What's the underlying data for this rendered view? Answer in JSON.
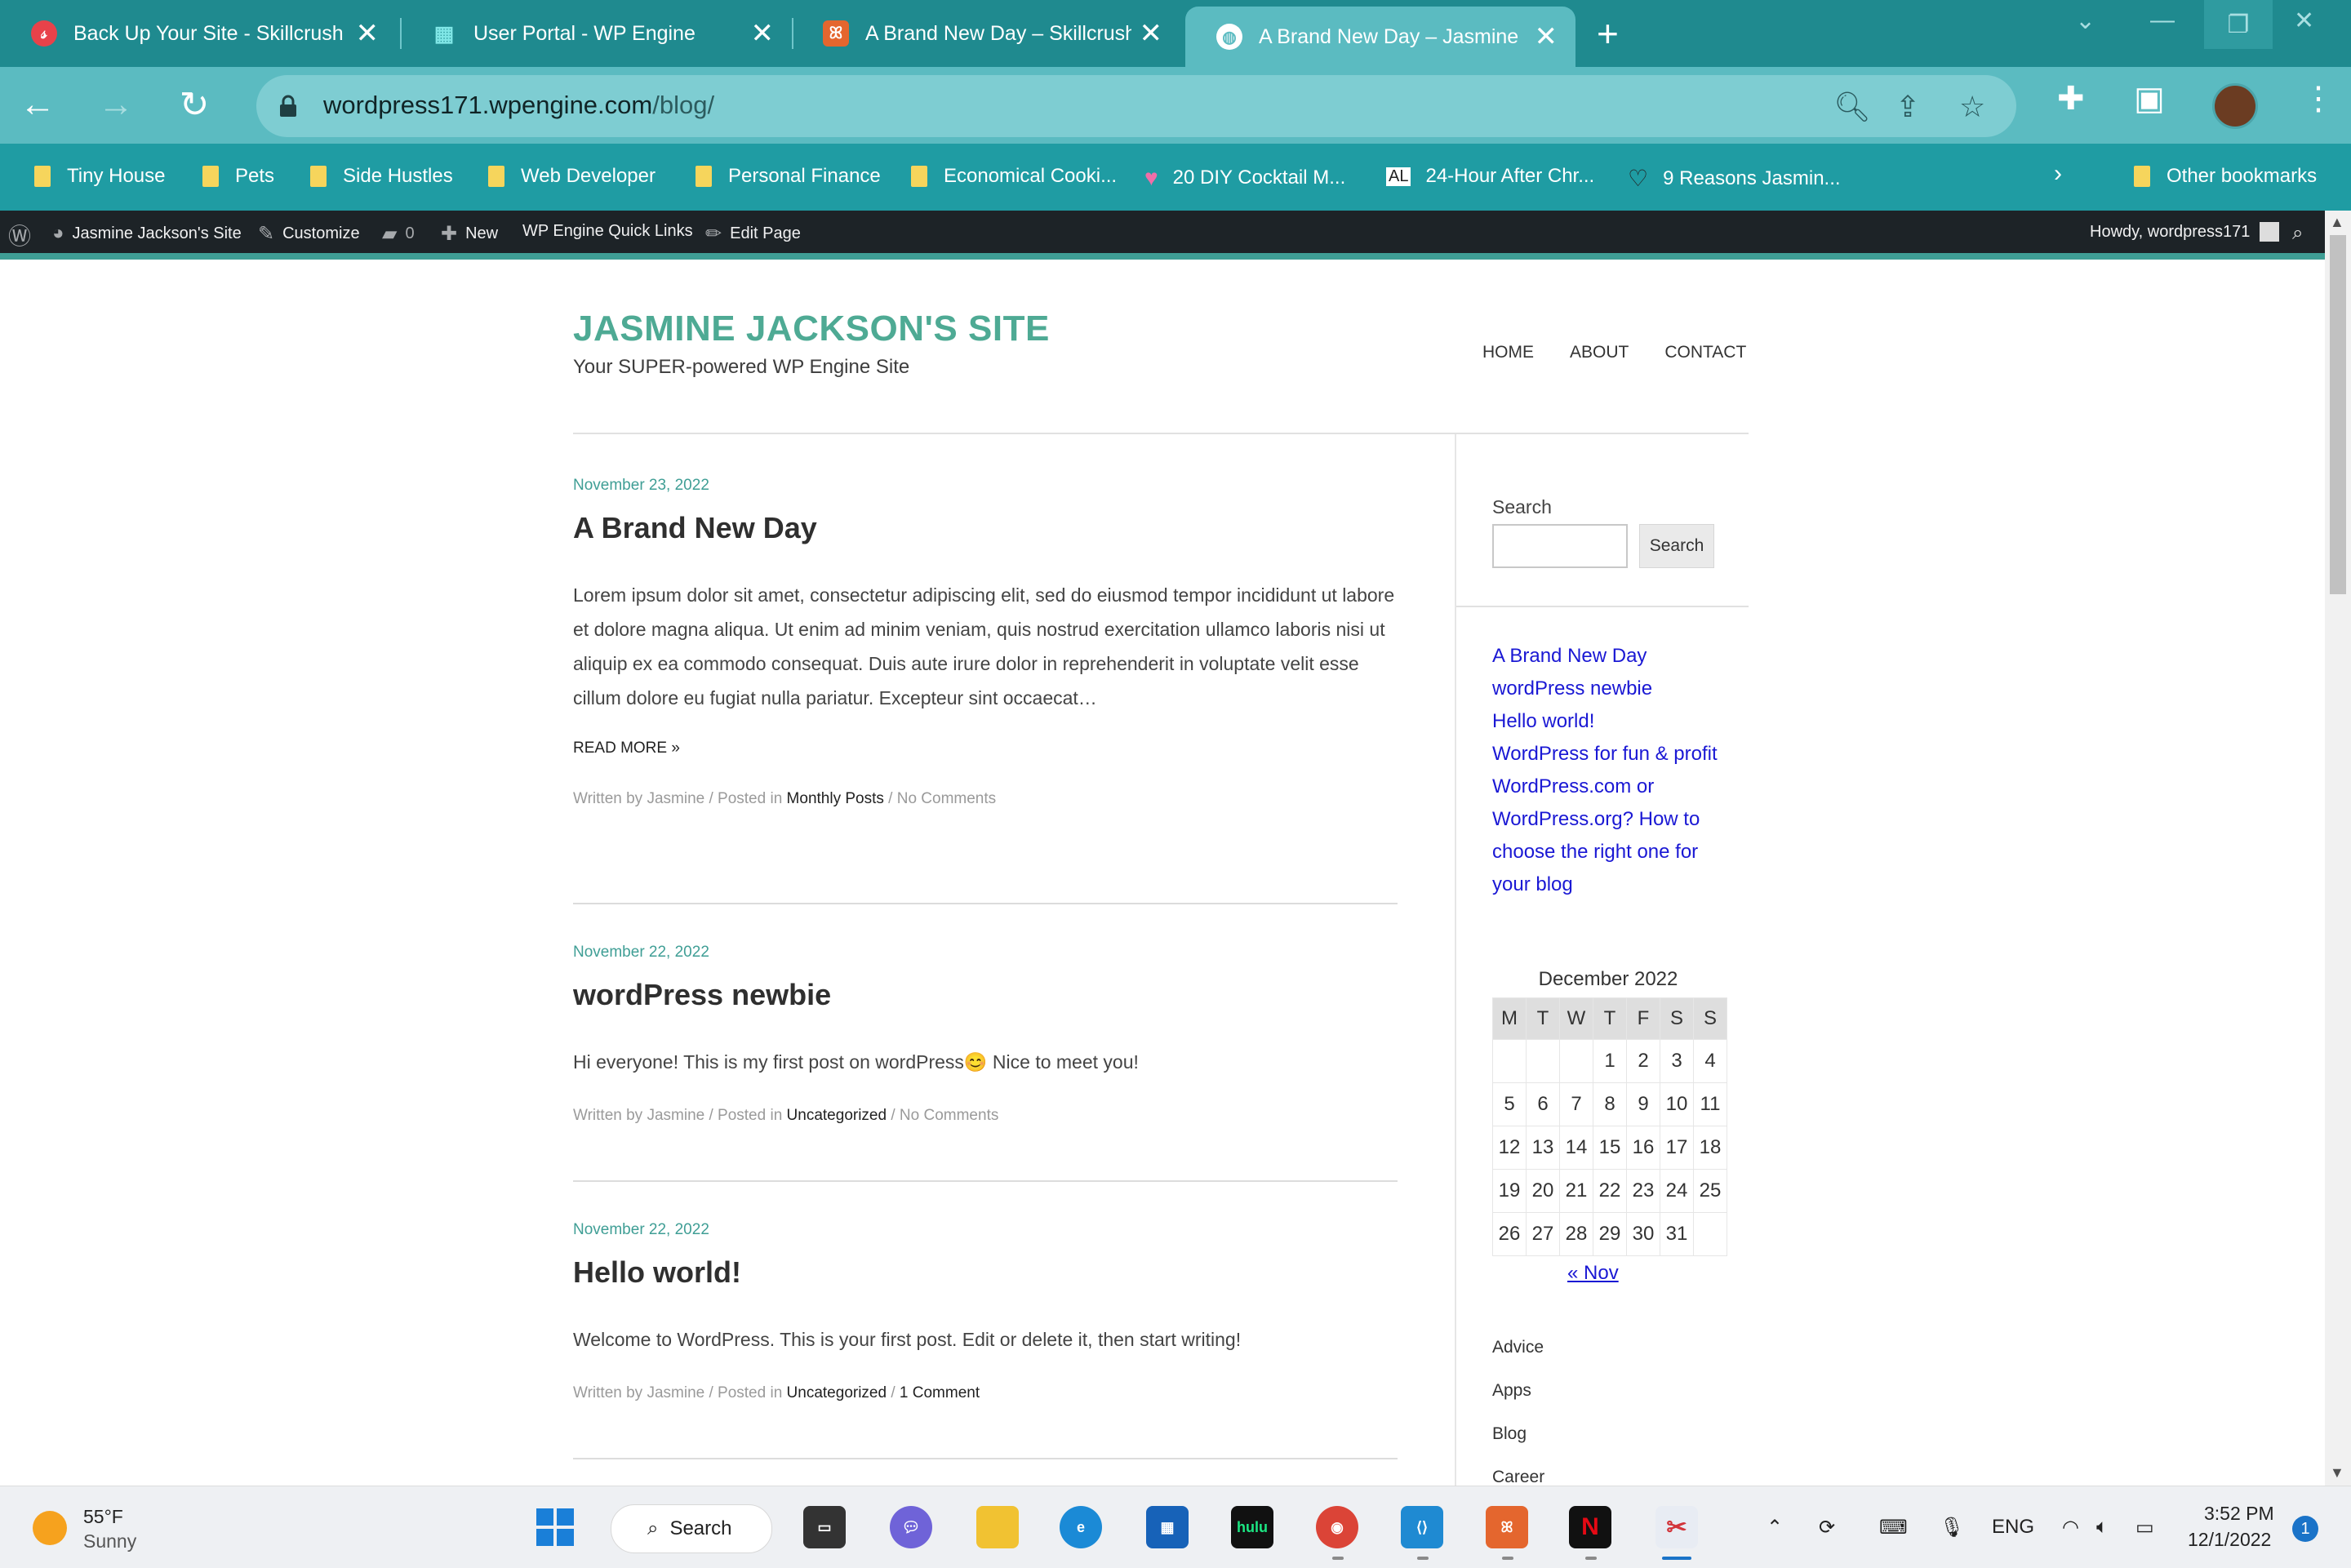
{
  "browser": {
    "tabs": [
      {
        "title": "Back Up Your Site - Skillcrush",
        "icon": "skillcrush-icon",
        "active": false
      },
      {
        "title": "User Portal - WP Engine",
        "icon": "wpengine-icon",
        "active": false
      },
      {
        "title": "A Brand New Day – Skillcrush S",
        "icon": "xampp-icon",
        "active": false
      },
      {
        "title": "A Brand New Day – Jasmine Ja",
        "icon": "globe-icon",
        "active": true
      }
    ],
    "new_tab_label": "+",
    "url_host": "wordpress171.wpengine.com",
    "url_path": "/blog/",
    "bookmarks": [
      {
        "label": "Tiny House",
        "icon": "folder-icon"
      },
      {
        "label": "Pets",
        "icon": "folder-icon"
      },
      {
        "label": "Side Hustles",
        "icon": "folder-icon"
      },
      {
        "label": "Web Developer",
        "icon": "folder-icon"
      },
      {
        "label": "Personal Finance",
        "icon": "folder-icon"
      },
      {
        "label": "Economical Cooki...",
        "icon": "folder-icon"
      },
      {
        "label": "20 DIY Cocktail M...",
        "icon": "heart-icon"
      },
      {
        "label": "24-Hour After Chr...",
        "icon": "al-icon"
      },
      {
        "label": "9 Reasons Jasmin...",
        "icon": "heart-outline-icon"
      }
    ],
    "other_bookmarks": "Other bookmarks"
  },
  "adminbar": {
    "site": "Jasmine Jackson's Site",
    "customize": "Customize",
    "comments": "0",
    "new": "New",
    "quicklinks": "WP Engine Quick Links",
    "edit": "Edit Page",
    "howdy": "Howdy, wordpress171"
  },
  "site": {
    "title": "JASMINE JACKSON'S SITE",
    "tagline": "Your SUPER-powered WP Engine Site",
    "nav": [
      "HOME",
      "ABOUT",
      "CONTACT"
    ]
  },
  "posts": [
    {
      "date": "November 23, 2022",
      "title": "A Brand New Day",
      "excerpt": "Lorem ipsum dolor sit amet, consectetur adipiscing elit, sed do eiusmod tempor incididunt ut labore et dolore magna aliqua. Ut enim ad minim veniam, quis nostrud exercitation ullamco laboris nisi ut aliquip ex ea commodo consequat. Duis aute irure dolor in reprehenderit in voluptate velit esse cillum dolore eu fugiat nulla pariatur. Excepteur sint occaecat…",
      "read_more": "READ MORE »",
      "meta_prefix": "Written by Jasmine / Posted in ",
      "category": "Monthly Posts",
      "comments": "No Comments"
    },
    {
      "date": "November 22, 2022",
      "title": "wordPress newbie",
      "excerpt": "Hi everyone! This is my first post on wordPress😊 Nice to meet you!",
      "meta_prefix": "Written by Jasmine / Posted in ",
      "category": "Uncategorized",
      "comments": "No Comments"
    },
    {
      "date": "November 22, 2022",
      "title": "Hello world!",
      "excerpt": "Welcome to WordPress. This is your first post. Edit or delete it, then start writing!",
      "meta_prefix": "Written by Jasmine / Posted in ",
      "category": "Uncategorized",
      "comments": "1 Comment"
    }
  ],
  "sidebar": {
    "search_label": "Search",
    "search_button": "Search",
    "recent_posts": [
      "A Brand New Day",
      "wordPress newbie",
      "Hello world!",
      "WordPress for fun & profit",
      "WordPress.com or WordPress.org? How to choose the right one for your blog"
    ],
    "calendar": {
      "caption": "December 2022",
      "days": [
        "M",
        "T",
        "W",
        "T",
        "F",
        "S",
        "S"
      ],
      "weeks": [
        [
          "",
          "",
          "",
          "1",
          "2",
          "3",
          "4"
        ],
        [
          "5",
          "6",
          "7",
          "8",
          "9",
          "10",
          "11"
        ],
        [
          "12",
          "13",
          "14",
          "15",
          "16",
          "17",
          "18"
        ],
        [
          "19",
          "20",
          "21",
          "22",
          "23",
          "24",
          "25"
        ],
        [
          "26",
          "27",
          "28",
          "29",
          "30",
          "31",
          ""
        ]
      ],
      "prev": "« Nov"
    },
    "categories": [
      "Advice",
      "Apps",
      "Blog",
      "Career"
    ]
  },
  "taskbar": {
    "temperature": "55°F",
    "condition": "Sunny",
    "search": "Search",
    "language": "ENG",
    "time": "3:52 PM",
    "date": "12/1/2022",
    "notifications": "1"
  },
  "colors": {
    "tabstrip": "#1f8a8f",
    "toolbar": "#5bbbc1",
    "bookmarks_bar": "#1f9ca3",
    "site_title": "#4eaa94",
    "link": "#1a18d4"
  }
}
